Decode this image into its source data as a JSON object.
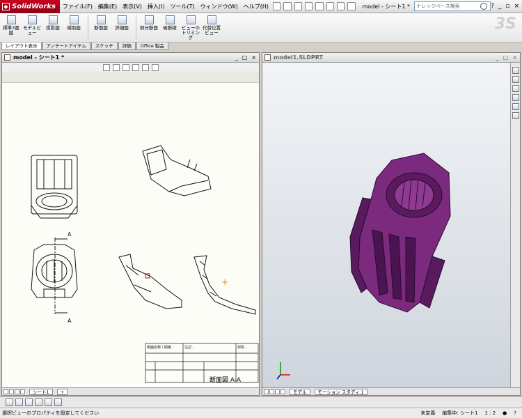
{
  "app": {
    "logo": "SolidWorks",
    "document": "model - シート1 *"
  },
  "menu": [
    "ファイル(F)",
    "編集(E)",
    "表示(V)",
    "挿入(I)",
    "ツール(T)",
    "ウィンドウ(W)",
    "ヘルプ(H)"
  ],
  "search": {
    "placeholder": "ナレッジベース検索"
  },
  "commands": [
    {
      "label": "標準3面図"
    },
    {
      "label": "モデルビュー"
    },
    {
      "label": "投影図"
    },
    {
      "label": "補助図"
    },
    {
      "label": "断面図"
    },
    {
      "label": "詳細図"
    },
    {
      "label": "部分断面"
    },
    {
      "label": "破断線"
    },
    {
      "label": "ビューのトリミング"
    },
    {
      "label": "代替位置ビュー"
    }
  ],
  "tabs": [
    "レイアウト表示",
    "アノテートアイテム",
    "スケッチ",
    "評価",
    "Office 製品"
  ],
  "drawing_window": {
    "title": "model - シート1 *",
    "section_label": "断面図 A-A",
    "section_letter": "A",
    "sheet_tab": "シート1"
  },
  "part_window": {
    "title": "model1.SLDPRT",
    "tabs": [
      "モデル",
      "モーション スタディ 1"
    ]
  },
  "titleblock": {
    "cell1": "図面名称 / 図番 :",
    "cell2": "注記 :",
    "cell3": "材質 :"
  },
  "status": {
    "left": "選択ビューのプロパティを設定してください",
    "state": "未定義",
    "editing": "編集中: シート1",
    "scale": "1 : 2"
  },
  "colors": {
    "part": "#7c2a7e",
    "part_dark": "#4a1450",
    "accent": "#c8001e"
  }
}
